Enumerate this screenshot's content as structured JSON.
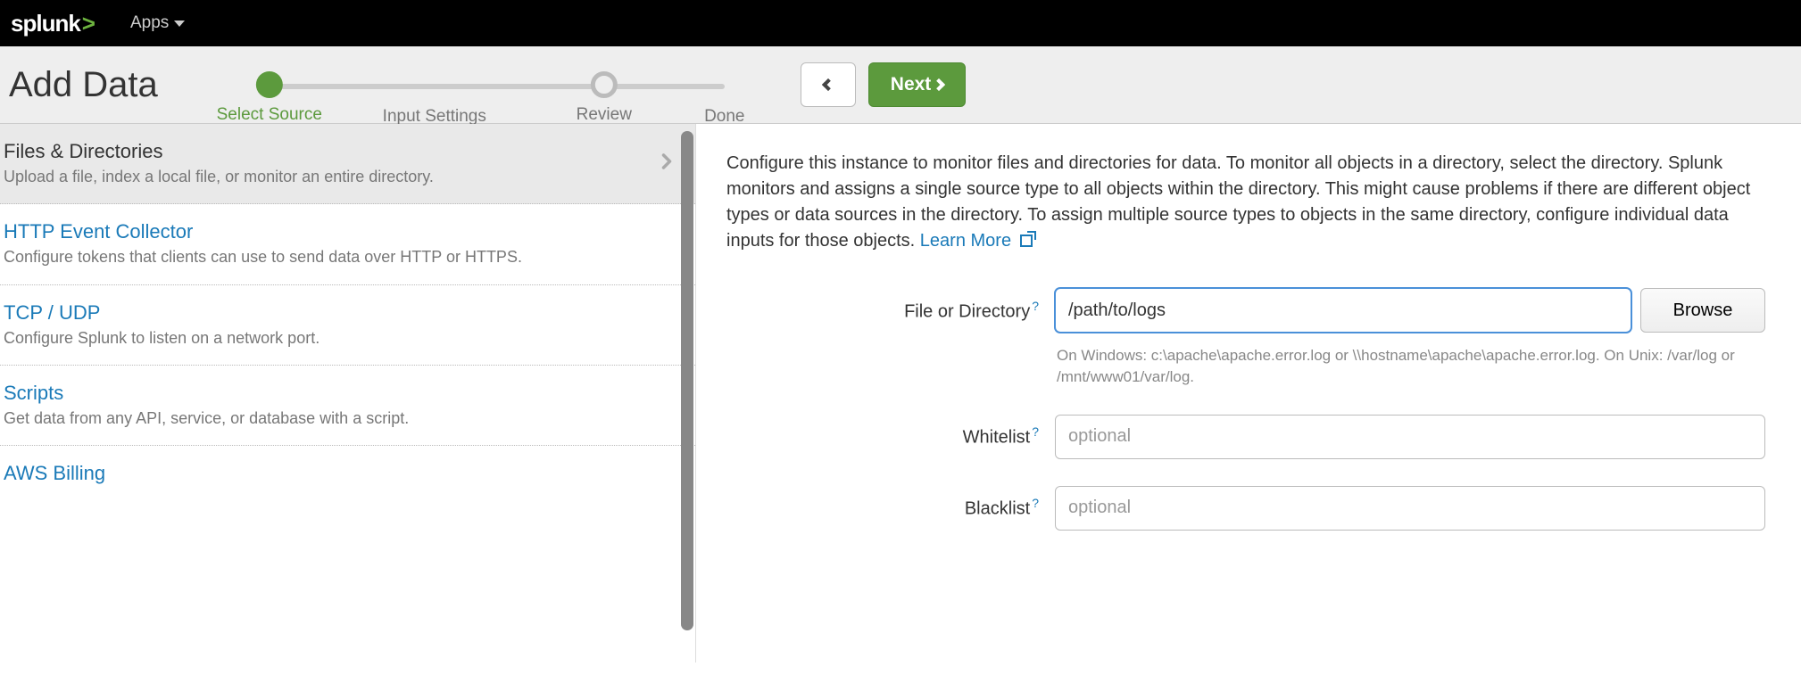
{
  "topbar": {
    "logo_text": "splunk",
    "apps_label": "Apps"
  },
  "header": {
    "title": "Add Data",
    "steps": [
      {
        "label": "Select Source",
        "state": "active"
      },
      {
        "label": "Input Settings",
        "state": "future"
      },
      {
        "label": "Review",
        "state": "future-hollow"
      },
      {
        "label": "Done",
        "state": "future"
      }
    ],
    "back_label": "",
    "next_label": "Next"
  },
  "sources": [
    {
      "title": "Files & Directories",
      "desc": "Upload a file, index a local file, or monitor an entire directory.",
      "selected": true
    },
    {
      "title": "HTTP Event Collector",
      "desc": "Configure tokens that clients can use to send data over HTTP or HTTPS."
    },
    {
      "title": "TCP / UDP",
      "desc": "Configure Splunk to listen on a network port."
    },
    {
      "title": "Scripts",
      "desc": "Get data from any API, service, or database with a script."
    },
    {
      "title": "AWS Billing",
      "desc": ""
    }
  ],
  "config": {
    "intro": "Configure this instance to monitor files and directories for data. To monitor all objects in a directory, select the directory. Splunk monitors and assigns a single source type to all objects within the directory. This might cause problems if there are different object types or data sources in the directory. To assign multiple source types to objects in the same directory, configure individual data inputs for those objects. ",
    "learn_more": "Learn More",
    "file_label": "File or Directory",
    "file_value": "/path/to/logs",
    "browse_label": "Browse",
    "file_hint": "On Windows: c:\\apache\\apache.error.log or \\\\hostname\\apache\\apache.error.log. On Unix: /var/log or /mnt/www01/var/log.",
    "whitelist_label": "Whitelist",
    "whitelist_placeholder": "optional",
    "blacklist_label": "Blacklist",
    "blacklist_placeholder": "optional"
  }
}
